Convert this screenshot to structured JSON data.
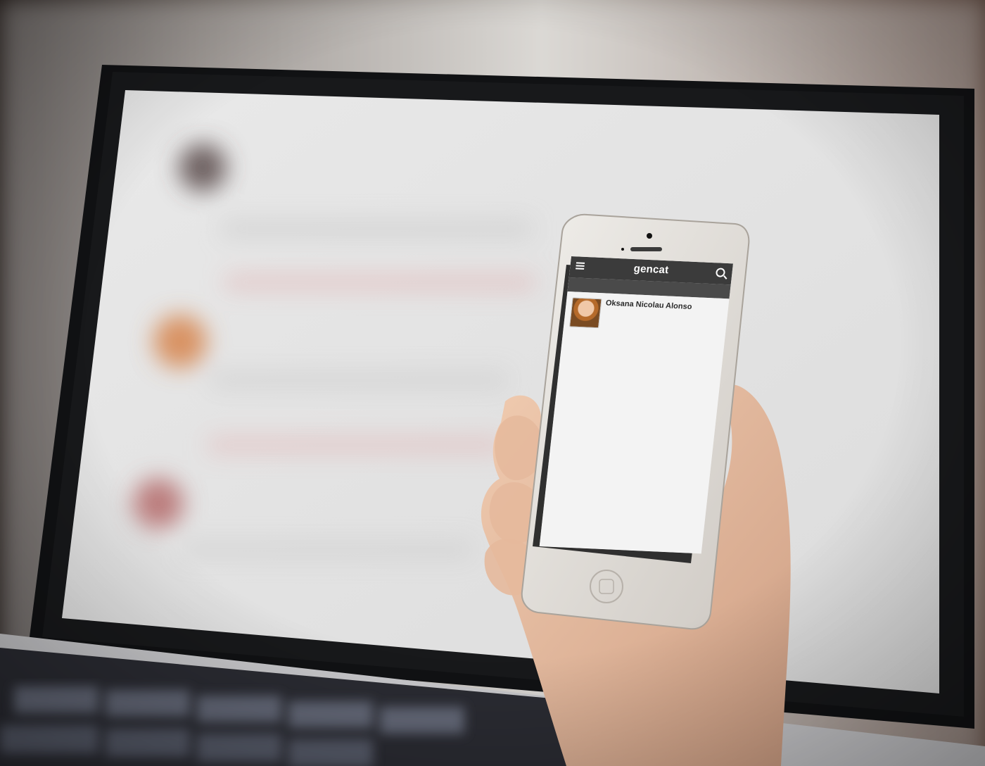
{
  "scene": {
    "wall_color": "#d8d5d0",
    "laptop_bezel_color": "#141414",
    "laptop_body_color": "#c8c8cb",
    "laptop_screen_bg": "#ececec",
    "keyboard_color": "#2b2c33",
    "phone_body_color": "#e8e6e3",
    "skin_color": "#e8c1a3"
  },
  "phone_app": {
    "brand": "gencat",
    "subbar_text": "",
    "profile": {
      "name": "Oksana Nicolau Alonso",
      "bio": ""
    },
    "icons": {
      "menu": "menu-icon",
      "search": "search-icon",
      "avatar": "avatar"
    }
  }
}
